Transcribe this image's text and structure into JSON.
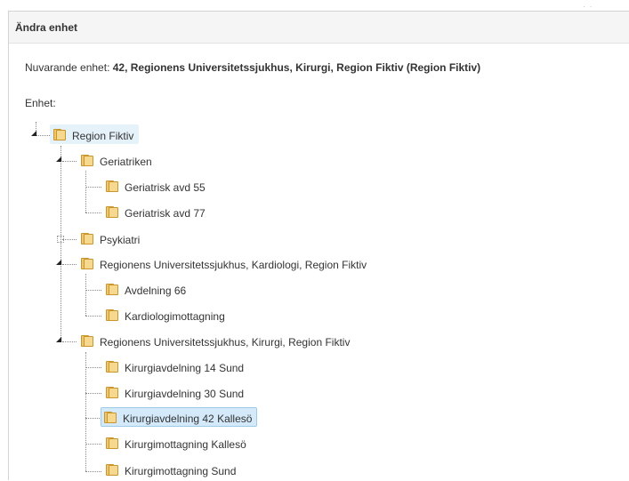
{
  "panel": {
    "title": "Ändra enhet",
    "current_unit_prefix": "Nuvarande enhet:",
    "current_unit_value": "42, Regionens Universitetssjukhus, Kirurgi, Region Fiktiv (Region Fiktiv)",
    "unit_label": "Enhet:"
  },
  "tree": {
    "root": {
      "label": "Region Fiktiv",
      "expanded": true
    },
    "nodes": [
      {
        "label": "Geriatriken",
        "expanded": true
      },
      {
        "label": "Geriatrisk avd 55"
      },
      {
        "label": "Geriatrisk avd 77"
      },
      {
        "label": "Psykiatri",
        "expanded": false
      },
      {
        "label": "Regionens Universitetssjukhus, Kardiologi, Region Fiktiv",
        "expanded": true
      },
      {
        "label": "Avdelning 66"
      },
      {
        "label": "Kardiologimottagning"
      },
      {
        "label": "Regionens Universitetssjukhus, Kirurgi, Region Fiktiv",
        "expanded": true
      },
      {
        "label": "Kirurgiavdelning 14 Sund"
      },
      {
        "label": "Kirurgiavdelning 30 Sund"
      },
      {
        "label": "Kirurgiavdelning 42 Kallesö",
        "selected": true
      },
      {
        "label": "Kirurgimottagning Kallesö"
      },
      {
        "label": "Kirurgimottagning Sund"
      }
    ]
  },
  "colors": {
    "selection_bg": "#d4eafa",
    "selection_border": "#9ccbe8",
    "folder": "#f0c66a"
  },
  "icons": {
    "expanded": "expand-triangle-icon",
    "collapsed": "collapse-plus-icon",
    "node": "folder-icon"
  }
}
